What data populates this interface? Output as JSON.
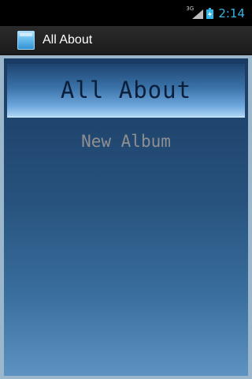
{
  "status_bar": {
    "network_label": "3G",
    "time": "2:14",
    "icons": [
      "signal-icon",
      "battery-icon"
    ]
  },
  "title_bar": {
    "app_icon": "app-icon",
    "title": "All About"
  },
  "main": {
    "header_title": "All About",
    "items": [
      {
        "label": "New Album"
      }
    ]
  },
  "colors": {
    "status_time": "#33b5e5",
    "panel_top": "#1a3b63",
    "panel_bottom": "#5d92c2",
    "header_text": "#0c1f3a",
    "item_text": "#8f8f8f"
  }
}
